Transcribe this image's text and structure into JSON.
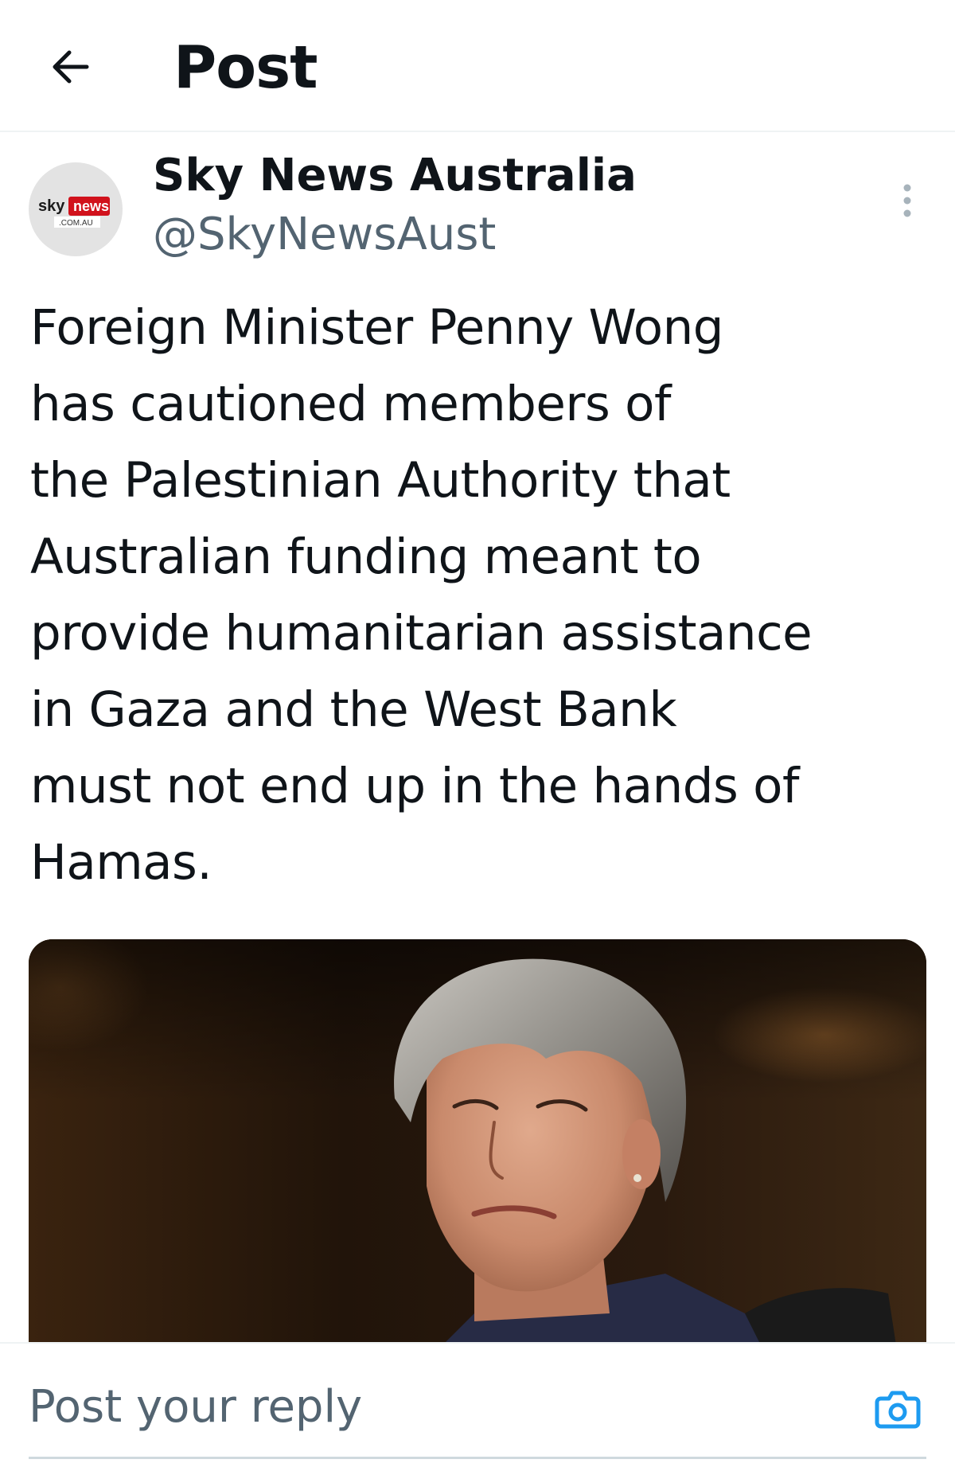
{
  "header": {
    "back_icon": "arrow-left-icon",
    "title": "Post"
  },
  "post": {
    "author": {
      "name": "Sky News Australia",
      "handle": "@SkyNewsAust",
      "avatar_logo": {
        "sky": "sky",
        "news": "news",
        "domain": ".COM.AU"
      }
    },
    "more_icon": "more-vertical-icon",
    "text": "Foreign Minister Penny Wong\nhas cautioned members of\nthe Palestinian Authority that\nAustralian funding meant to\nprovide humanitarian assistance\nin Gaza and the West Bank\nmust not end up in the hands of\nHamas.",
    "media": {
      "type": "photo"
    }
  },
  "reply": {
    "placeholder": "Post your reply",
    "camera_icon": "camera-icon"
  },
  "colors": {
    "text_primary": "#0f1419",
    "text_secondary": "#536471",
    "accent": "#1d9bf0",
    "divider": "#eff3f4",
    "logo_red": "#d1121c"
  }
}
